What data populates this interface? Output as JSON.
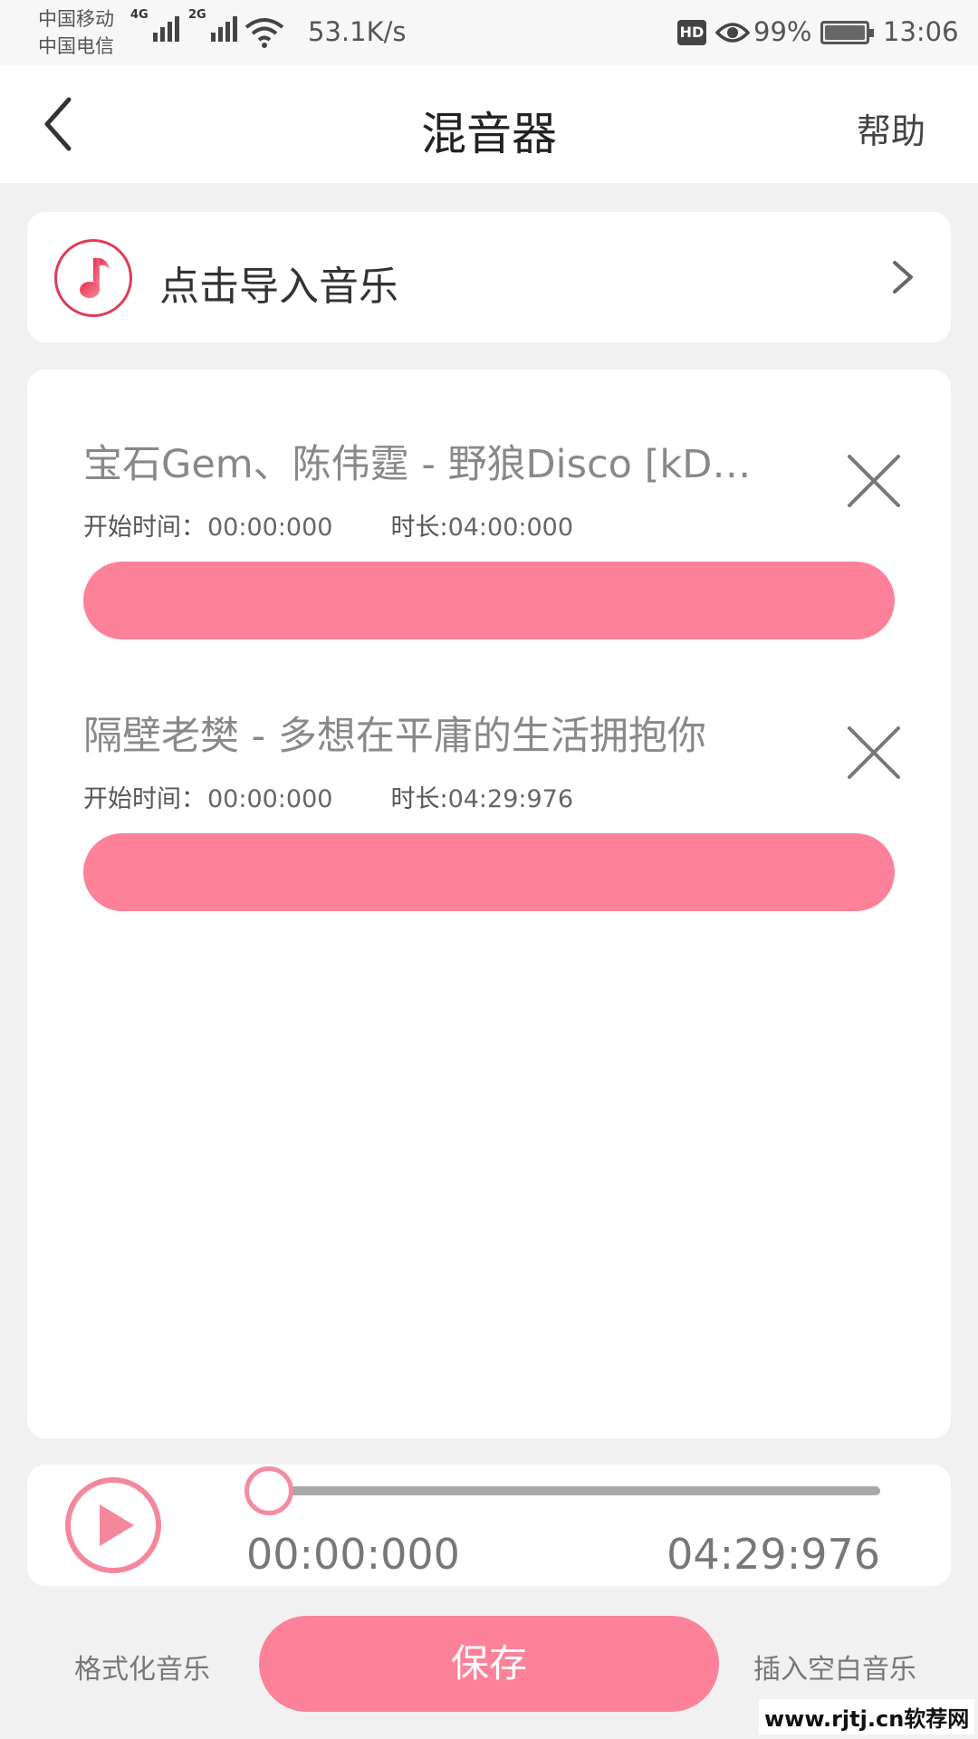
{
  "status_bar": {
    "carrier_1": "中国移动",
    "carrier_2": "中国电信",
    "net_1": "4G",
    "net_2": "2G",
    "net_speed": "53.1K/s",
    "hd_badge": "HD",
    "battery_percent": "99%",
    "time": "13:06"
  },
  "header": {
    "title": "混音器",
    "help_label": "帮助"
  },
  "import": {
    "label": "点击导入音乐"
  },
  "tracks": [
    {
      "name": "宝石Gem、陈伟霆 - 野狼Disco [kD…",
      "start_label": "开始时间：",
      "start_value": "00:00:000",
      "duration_label": "时长:",
      "duration_value": "04:00:000"
    },
    {
      "name": "隔壁老樊 - 多想在平庸的生活拥抱你",
      "start_label": "开始时间：",
      "start_value": "00:00:000",
      "duration_label": "时长:",
      "duration_value": "04:29:976"
    }
  ],
  "player": {
    "current_time": "00:00:000",
    "total_time": "04:29:976",
    "progress": 0
  },
  "actions": {
    "format_label": "格式化音乐",
    "save_label": "保存",
    "insert_label": "插入空白音乐"
  },
  "watermark": "www.rjtj.cn软荐网",
  "colors": {
    "accent": "#fc8199",
    "icon_red": "#e03b57",
    "background": "#f1f1f1"
  }
}
